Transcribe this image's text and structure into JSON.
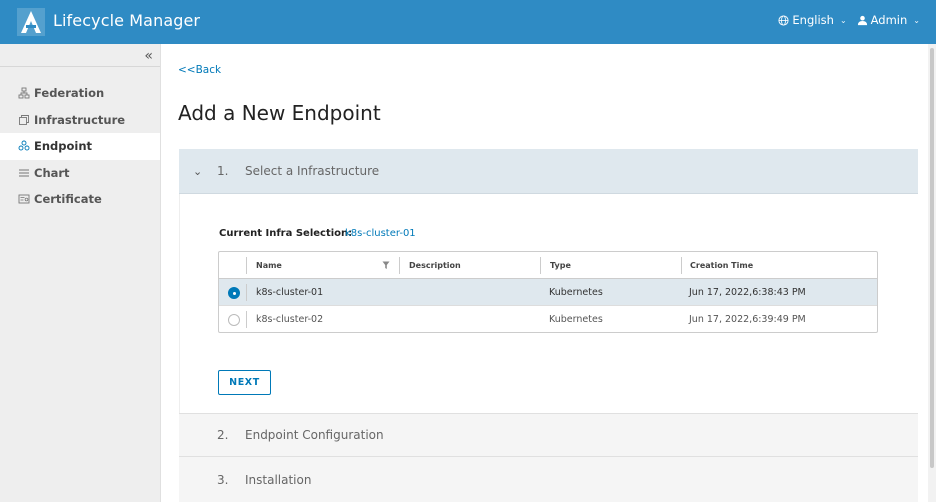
{
  "header": {
    "app_title": "Lifecycle Manager",
    "language": "English",
    "user": "Admin",
    "brand_color": "#2f8bc4"
  },
  "sidebar": {
    "collapse_icon": "double-chevron-left-icon",
    "items": [
      {
        "label": "Federation",
        "icon": "federation-icon"
      },
      {
        "label": "Infrastructure",
        "icon": "infrastructure-icon"
      },
      {
        "label": "Endpoint",
        "icon": "endpoint-icon",
        "active": true
      },
      {
        "label": "Chart",
        "icon": "chart-icon"
      },
      {
        "label": "Certificate",
        "icon": "certificate-icon"
      }
    ]
  },
  "main": {
    "back_label": "<<Back",
    "title": "Add a New Endpoint",
    "steps": [
      {
        "num": "1.",
        "label": "Select a Infrastructure",
        "expanded": true
      },
      {
        "num": "2.",
        "label": "Endpoint Configuration"
      },
      {
        "num": "3.",
        "label": "Installation"
      }
    ],
    "current_selection_label": "Current Infra Selection:",
    "current_selection_value": "k8s-cluster-01",
    "table": {
      "columns": [
        "Name",
        "Description",
        "Type",
        "Creation Time"
      ],
      "rows": [
        {
          "name": "k8s-cluster-01",
          "description": "",
          "type": "Kubernetes",
          "created": "Jun 17, 2022,6:38:43 PM",
          "selected": true
        },
        {
          "name": "k8s-cluster-02",
          "description": "",
          "type": "Kubernetes",
          "created": "Jun 17, 2022,6:39:49 PM",
          "selected": false
        }
      ]
    },
    "next_label": "NEXT"
  },
  "colors": {
    "accent": "#0079b8",
    "selected_row": "#dfe8ee"
  }
}
